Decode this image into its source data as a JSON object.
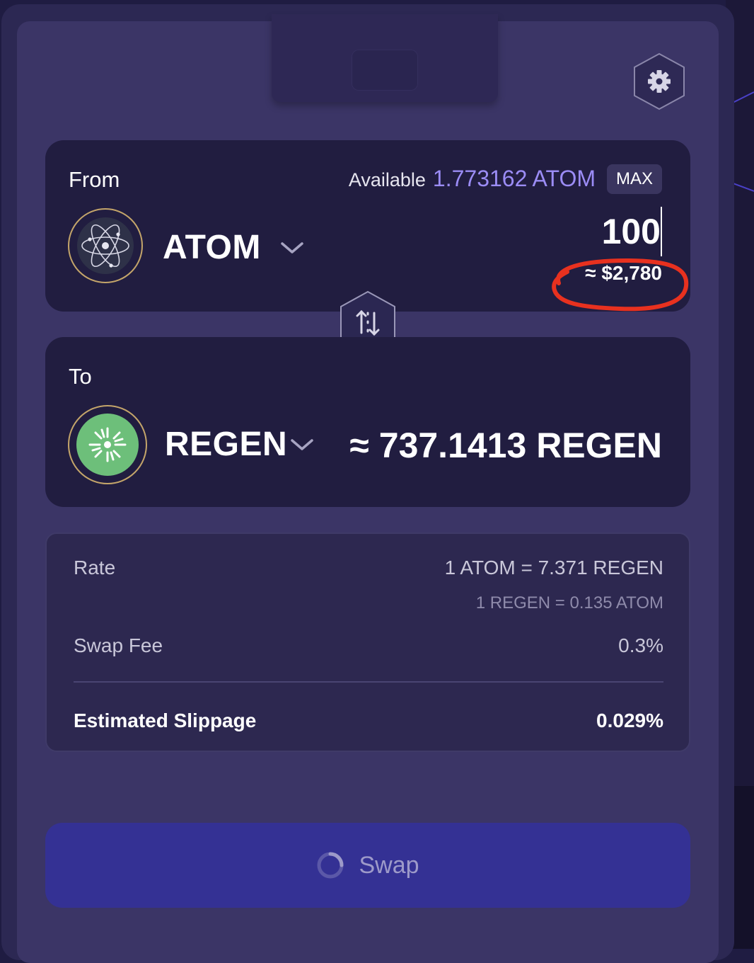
{
  "settings_icon": "gear-icon",
  "from": {
    "label": "From",
    "available_label": "Available",
    "available_value": "1.773162 ATOM",
    "max_label": "MAX",
    "token": "ATOM",
    "amount": "100",
    "usd_value": "≈ $2,780"
  },
  "to": {
    "label": "To",
    "token": "REGEN",
    "amount": "≈ 737.1413 REGEN"
  },
  "details": {
    "rate_label": "Rate",
    "rate_value": "1 ATOM = 7.371 REGEN",
    "rate_inverse": "1 REGEN = 0.135 ATOM",
    "fee_label": "Swap Fee",
    "fee_value": "0.3%",
    "slippage_label": "Estimated Slippage",
    "slippage_value": "0.029%"
  },
  "swap_button": {
    "label": "Swap"
  },
  "colors": {
    "accent": "#9b8cf5",
    "swap_button": "#343194",
    "card": "#211d40",
    "annotation": "#e8311f",
    "regen_green": "#6dbf7a"
  }
}
